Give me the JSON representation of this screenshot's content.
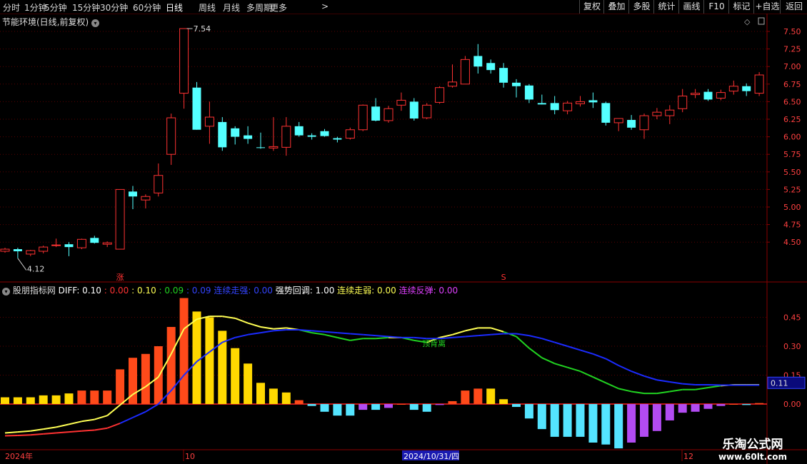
{
  "toolbar": {
    "periods": [
      "分时",
      "1分钟",
      "5分钟",
      "15分钟",
      "30分钟",
      "60分钟",
      "日线",
      "周线",
      "月线",
      "多周期",
      "更多"
    ],
    "more_icon": "chevron-right-icon",
    "active_period": "日线",
    "right_buttons": [
      "复权",
      "叠加",
      "多股",
      "统计",
      "画线",
      "F10",
      "标记",
      "+自选",
      "返回"
    ]
  },
  "stock": {
    "title": "节能环境(日线,前复权)",
    "dropdown_icon": "chevron-down-icon",
    "high_label": "7.54",
    "low_label": "4.12",
    "marker_zhang": "涨",
    "marker_s": "S"
  },
  "indicator": {
    "name": "股朋指标网",
    "diff_label": "DIFF: 0.10",
    "v1": ": 0.00",
    "v2": ": 0.10",
    "v3": ": 0.09",
    "v4": ": 0.09",
    "lianxu_zouqiang": "连续走强: 0.00",
    "qiangshi_huidiao": "强势回调: 1.00",
    "lianxu_zouruo": "连续走弱: 0.00",
    "lianxu_fantan": "连续反弹: 0.00",
    "divergence_label": "顶背离",
    "current_value_box": "0.11"
  },
  "price_axis": [
    "7.50",
    "7.25",
    "7.00",
    "6.75",
    "6.50",
    "6.25",
    "6.00",
    "5.75",
    "5.50",
    "5.25",
    "5.00",
    "4.75",
    "4.50"
  ],
  "ind_axis": [
    "0.45",
    "0.30",
    "0.15",
    "0.00"
  ],
  "time_axis": {
    "start": "2024年",
    "oct": "10",
    "cursor_date": "2024/10/31/四",
    "dec": "12"
  },
  "colors": {
    "up": "#ff3232",
    "down": "#54ffff",
    "diff": "#ffff54",
    "dea": "#1b2bff",
    "dea_weak": "#21d321",
    "bar_red": "#ff4a1a",
    "bar_yellow": "#ffd800",
    "bar_cyan": "#54e4ff",
    "bar_purple": "#b24bf2"
  },
  "watermark": {
    "line1": "乐淘公式网",
    "line2": "www.60lt.com"
  },
  "chart_data": {
    "type": "candlestick",
    "candles": [
      [
        4.37,
        4.42,
        4.35,
        4.4
      ],
      [
        4.4,
        4.42,
        4.27,
        4.37
      ],
      [
        4.33,
        4.39,
        4.3,
        4.38
      ],
      [
        4.37,
        4.45,
        4.34,
        4.43
      ],
      [
        4.45,
        4.55,
        4.43,
        4.46
      ],
      [
        4.47,
        4.5,
        4.3,
        4.43
      ],
      [
        4.42,
        4.55,
        4.4,
        4.54
      ],
      [
        4.56,
        4.59,
        4.48,
        4.49
      ],
      [
        4.47,
        4.51,
        4.43,
        4.49
      ],
      [
        4.4,
        5.25,
        4.4,
        5.25
      ],
      [
        5.22,
        5.3,
        4.97,
        5.15
      ],
      [
        5.1,
        5.18,
        4.98,
        5.15
      ],
      [
        5.2,
        5.62,
        5.15,
        5.45
      ],
      [
        5.75,
        6.33,
        5.6,
        6.27
      ],
      [
        6.62,
        7.54,
        6.4,
        7.54
      ],
      [
        6.7,
        6.78,
        6.1,
        6.1
      ],
      [
        6.15,
        6.5,
        5.9,
        6.28
      ],
      [
        6.21,
        6.28,
        5.8,
        5.85
      ],
      [
        6.12,
        6.15,
        5.89,
        6.0
      ],
      [
        6.02,
        6.15,
        5.9,
        5.97
      ],
      [
        5.85,
        6.06,
        5.83,
        5.84
      ],
      [
        5.84,
        6.28,
        5.8,
        5.86
      ],
      [
        5.85,
        6.28,
        5.73,
        6.15
      ],
      [
        6.15,
        6.21,
        6.0,
        6.02
      ],
      [
        6.02,
        6.05,
        5.96,
        6.0
      ],
      [
        6.08,
        6.11,
        6.0,
        6.01
      ],
      [
        5.98,
        6.0,
        5.92,
        5.96
      ],
      [
        5.98,
        6.13,
        5.96,
        6.1
      ],
      [
        6.1,
        6.46,
        6.08,
        6.45
      ],
      [
        6.43,
        6.55,
        6.22,
        6.23
      ],
      [
        6.23,
        6.44,
        6.2,
        6.4
      ],
      [
        6.45,
        6.63,
        6.37,
        6.52
      ],
      [
        6.5,
        6.55,
        6.23,
        6.26
      ],
      [
        6.27,
        6.48,
        6.25,
        6.45
      ],
      [
        6.49,
        6.72,
        6.47,
        6.7
      ],
      [
        6.72,
        7.03,
        6.7,
        6.78
      ],
      [
        6.75,
        7.15,
        6.75,
        7.1
      ],
      [
        7.15,
        7.32,
        6.9,
        7.0
      ],
      [
        7.05,
        7.1,
        6.9,
        6.95
      ],
      [
        6.98,
        7.05,
        6.7,
        6.77
      ],
      [
        6.77,
        6.82,
        6.56,
        6.72
      ],
      [
        6.73,
        6.75,
        6.48,
        6.53
      ],
      [
        6.48,
        6.6,
        6.46,
        6.46
      ],
      [
        6.48,
        6.58,
        6.32,
        6.38
      ],
      [
        6.37,
        6.51,
        6.32,
        6.48
      ],
      [
        6.47,
        6.58,
        6.43,
        6.5
      ],
      [
        6.52,
        6.63,
        6.41,
        6.49
      ],
      [
        6.48,
        6.5,
        6.16,
        6.2
      ],
      [
        6.2,
        6.25,
        6.08,
        6.26
      ],
      [
        6.24,
        6.31,
        6.1,
        6.13
      ],
      [
        6.1,
        6.33,
        5.97,
        6.3
      ],
      [
        6.3,
        6.41,
        6.25,
        6.35
      ],
      [
        6.3,
        6.45,
        6.18,
        6.38
      ],
      [
        6.4,
        6.68,
        6.35,
        6.58
      ],
      [
        6.6,
        6.68,
        6.55,
        6.62
      ],
      [
        6.64,
        6.68,
        6.51,
        6.53
      ],
      [
        6.55,
        6.67,
        6.52,
        6.63
      ],
      [
        6.65,
        6.8,
        6.6,
        6.72
      ],
      [
        6.72,
        6.76,
        6.58,
        6.65
      ],
      [
        6.62,
        6.92,
        6.58,
        6.88
      ]
    ],
    "histogram": [
      0.035,
      0.035,
      0.035,
      0.045,
      0.045,
      0.055,
      0.07,
      0.07,
      0.07,
      0.18,
      0.24,
      0.26,
      0.3,
      0.4,
      0.55,
      0.48,
      0.45,
      0.38,
      0.29,
      0.21,
      0.11,
      0.08,
      0.06,
      0.02,
      -0.01,
      -0.04,
      -0.06,
      -0.06,
      -0.03,
      -0.03,
      -0.02,
      0.0,
      -0.03,
      -0.04,
      -0.005,
      0.015,
      0.07,
      0.08,
      0.08,
      0.025,
      -0.015,
      -0.075,
      -0.13,
      -0.17,
      -0.17,
      -0.17,
      -0.2,
      -0.21,
      -0.23,
      -0.2,
      -0.17,
      -0.14,
      -0.085,
      -0.045,
      -0.04,
      -0.025,
      -0.01,
      0.0,
      -0.005,
      0.005
    ],
    "dif": [
      -0.15,
      -0.145,
      -0.14,
      -0.13,
      -0.12,
      -0.105,
      -0.09,
      -0.08,
      -0.06,
      -0.005,
      0.05,
      0.09,
      0.14,
      0.26,
      0.39,
      0.44,
      0.455,
      0.455,
      0.445,
      0.42,
      0.4,
      0.39,
      0.395,
      0.385,
      0.37,
      0.36,
      0.345,
      0.33,
      0.34,
      0.34,
      0.345,
      0.345,
      0.33,
      0.32,
      0.345,
      0.36,
      0.38,
      0.395,
      0.395,
      0.375,
      0.35,
      0.29,
      0.24,
      0.21,
      0.19,
      0.17,
      0.14,
      0.11,
      0.08,
      0.065,
      0.055,
      0.055,
      0.065,
      0.075,
      0.075,
      0.085,
      0.095,
      0.1,
      0.1,
      0.1
    ],
    "dea": [
      -0.165,
      -0.163,
      -0.16,
      -0.155,
      -0.15,
      -0.145,
      -0.14,
      -0.135,
      -0.125,
      -0.1,
      -0.07,
      -0.04,
      0.0,
      0.07,
      0.15,
      0.22,
      0.27,
      0.32,
      0.345,
      0.36,
      0.37,
      0.38,
      0.385,
      0.385,
      0.38,
      0.375,
      0.37,
      0.365,
      0.36,
      0.355,
      0.35,
      0.345,
      0.345,
      0.34,
      0.34,
      0.345,
      0.35,
      0.355,
      0.36,
      0.365,
      0.365,
      0.355,
      0.34,
      0.32,
      0.3,
      0.28,
      0.26,
      0.235,
      0.2,
      0.17,
      0.145,
      0.125,
      0.115,
      0.105,
      0.1,
      0.1,
      0.098,
      0.098,
      0.098,
      0.098
    ]
  }
}
